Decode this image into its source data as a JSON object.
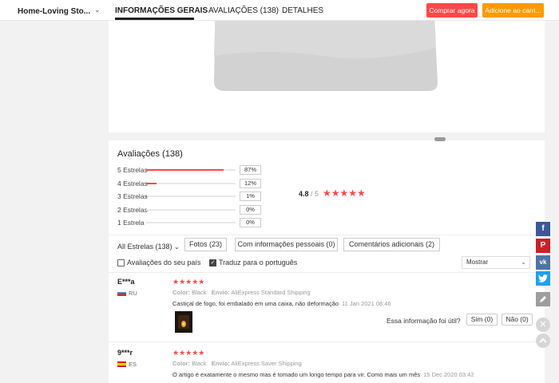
{
  "nav": {
    "store_name": "Home-Loving Sto...",
    "tabs": [
      {
        "label": "INFORMAÇÕES GERAIS"
      },
      {
        "label": "AVALIAÇÕES (138)"
      },
      {
        "label": "DETALHES"
      }
    ],
    "buy_label": "Comprar agora",
    "cart_label": "Adicione ao carri..."
  },
  "reviews": {
    "title": "Avaliações (138)",
    "breakdown": [
      {
        "label": "5 Estrelas",
        "pct": "87%",
        "value": 0.87
      },
      {
        "label": "4 Estrelas",
        "pct": "12%",
        "value": 0.12
      },
      {
        "label": "3 Estrelas",
        "pct": "1%",
        "value": 0.01
      },
      {
        "label": "2 Estrelas",
        "pct": "0%",
        "value": 0
      },
      {
        "label": "1 Estrela",
        "pct": "0%",
        "value": 0
      }
    ],
    "average": "4.8",
    "average_of": "/ 5",
    "average_stars": "★★★★★",
    "filters": {
      "all": "All Estrelas (138)",
      "photos": "Fotos (23)",
      "personal": "Com informações pessoais (0)",
      "additional": "Comentários adicionais (2)"
    },
    "options": {
      "own_country": "Avaliações do seu país",
      "translate": "Traduz para o português",
      "sort": "Mostrar"
    },
    "items": [
      {
        "name": "E***a",
        "country": "RU",
        "stars": "★★★★★",
        "color_label": "Color:",
        "color": "Black",
        "ship_label": "Envio:",
        "shipping": "AliExpress Standard Shipping",
        "text": "Castiçal de fogo, foi embalado em uma caixa, não deformação",
        "date": "11 Jan 2021 08:46",
        "helpful": "Essa informação foi útil?",
        "yes": "Sim (0)",
        "no": "Não (0)"
      },
      {
        "name": "9***r",
        "country": "ES",
        "stars": "★★★★★",
        "color_label": "Color:",
        "color": "Black",
        "ship_label": "Envio:",
        "shipping": "AliExpress Saver Shipping",
        "text": "O artigo é exatamente o mesmo mas é tomado um longo tempo para vir. Como mais um mês",
        "date": "15 Dec 2020 03:42"
      }
    ]
  },
  "social": [
    "facebook-icon",
    "pinterest-icon",
    "vk-icon",
    "twitter-icon",
    "edit-icon",
    "close-icon",
    "scroll-top-icon"
  ],
  "colors": {
    "accent": "#ff4747",
    "cart": "#ff9900",
    "facebook": "#3b5998",
    "pinterest": "#cb2027",
    "vk": "#4c75a3",
    "twitter": "#1da1f2"
  }
}
